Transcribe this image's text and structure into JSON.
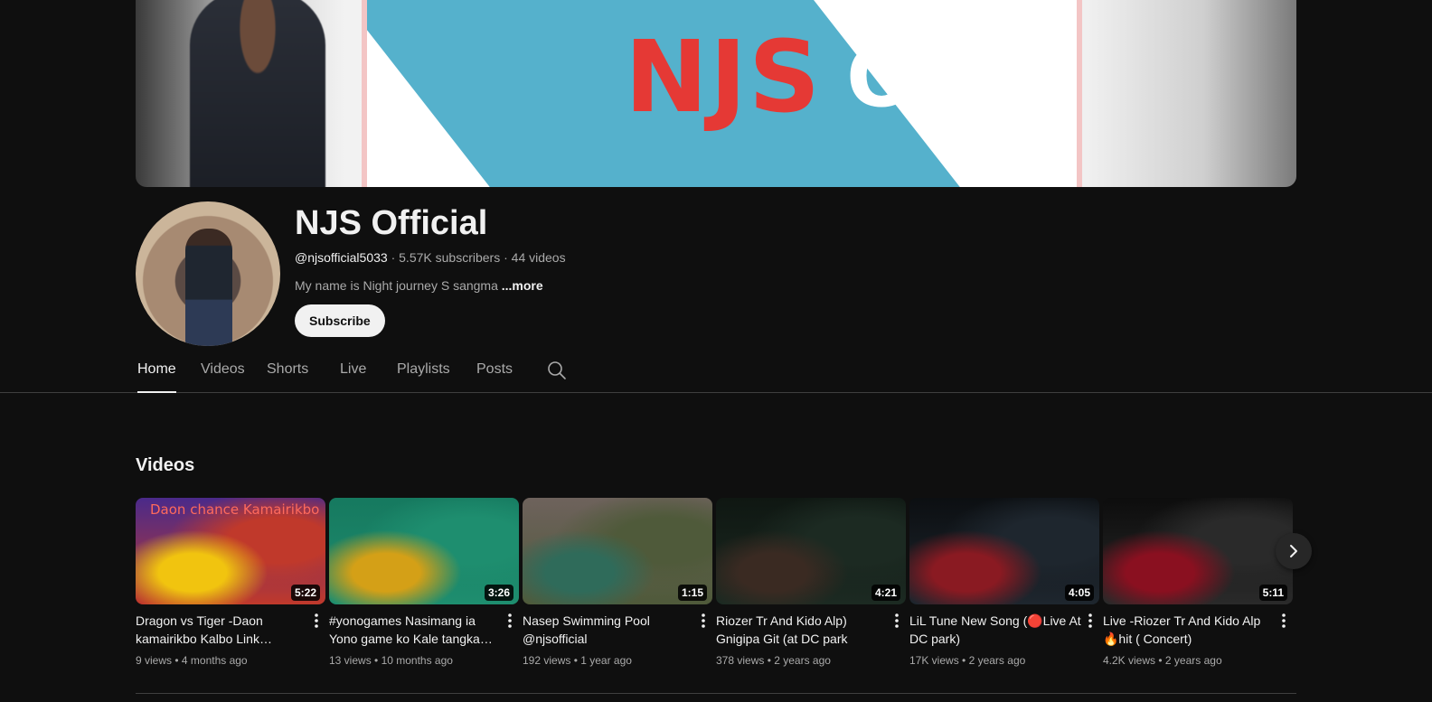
{
  "banner": {
    "title_red": "NJS",
    "title_white": "Official"
  },
  "channel": {
    "name": "NJS Official",
    "handle": "@njsofficial5033",
    "subscribers": "5.57K subscribers",
    "videos_count": "44 videos",
    "description": "My name is Night journey S sangma",
    "more_label": "...more",
    "subscribe_label": "Subscribe"
  },
  "tabs": [
    {
      "label": "Home",
      "active": true
    },
    {
      "label": "Videos"
    },
    {
      "label": "Shorts"
    },
    {
      "label": "Live"
    },
    {
      "label": "Playlists"
    },
    {
      "label": "Posts"
    }
  ],
  "section": {
    "title": "Videos"
  },
  "videos": [
    {
      "title": "Dragon vs Tiger -Daon kamairikbo Kalbo Link…",
      "views": "9 views",
      "age": "4 months ago",
      "duration": "5:22",
      "overlay": "Daon  chance  Kamairikbo",
      "colors": [
        "#4a2a8a",
        "#c0392b",
        "#f1c40f"
      ]
    },
    {
      "title": "#yonogames Nasimang ia Yono game ko Kale tangka…",
      "views": "13 views",
      "age": "10 months ago",
      "duration": "3:26",
      "colors": [
        "#16795f",
        "#1e8e6f",
        "#d4a017"
      ]
    },
    {
      "title": "Nasep Swimming Pool @njsofficial",
      "views": "192 views",
      "age": "1 year ago",
      "duration": "1:15",
      "colors": [
        "#6e625c",
        "#4f5a3a",
        "#2f6b5a"
      ]
    },
    {
      "title": "Riozer Tr And Kido Alp) Gnigipa Git (at DC park",
      "views": "378 views",
      "age": "2 years ago",
      "duration": "4:21",
      "colors": [
        "#0f1712",
        "#1c2a22",
        "#3a2a22"
      ]
    },
    {
      "title": "LiL Tune New Song (🔴Live At DC park)",
      "views": "17K views",
      "age": "2 years ago",
      "duration": "4:05",
      "colors": [
        "#0c0f12",
        "#1e262e",
        "#8a1a22"
      ]
    },
    {
      "title": "Live -Riozer Tr And Kido Alp 🔥hit ( Concert)",
      "views": "4.2K views",
      "age": "2 years ago",
      "duration": "5:11",
      "colors": [
        "#0d0d0d",
        "#2a2a2a",
        "#8a1020"
      ]
    }
  ]
}
